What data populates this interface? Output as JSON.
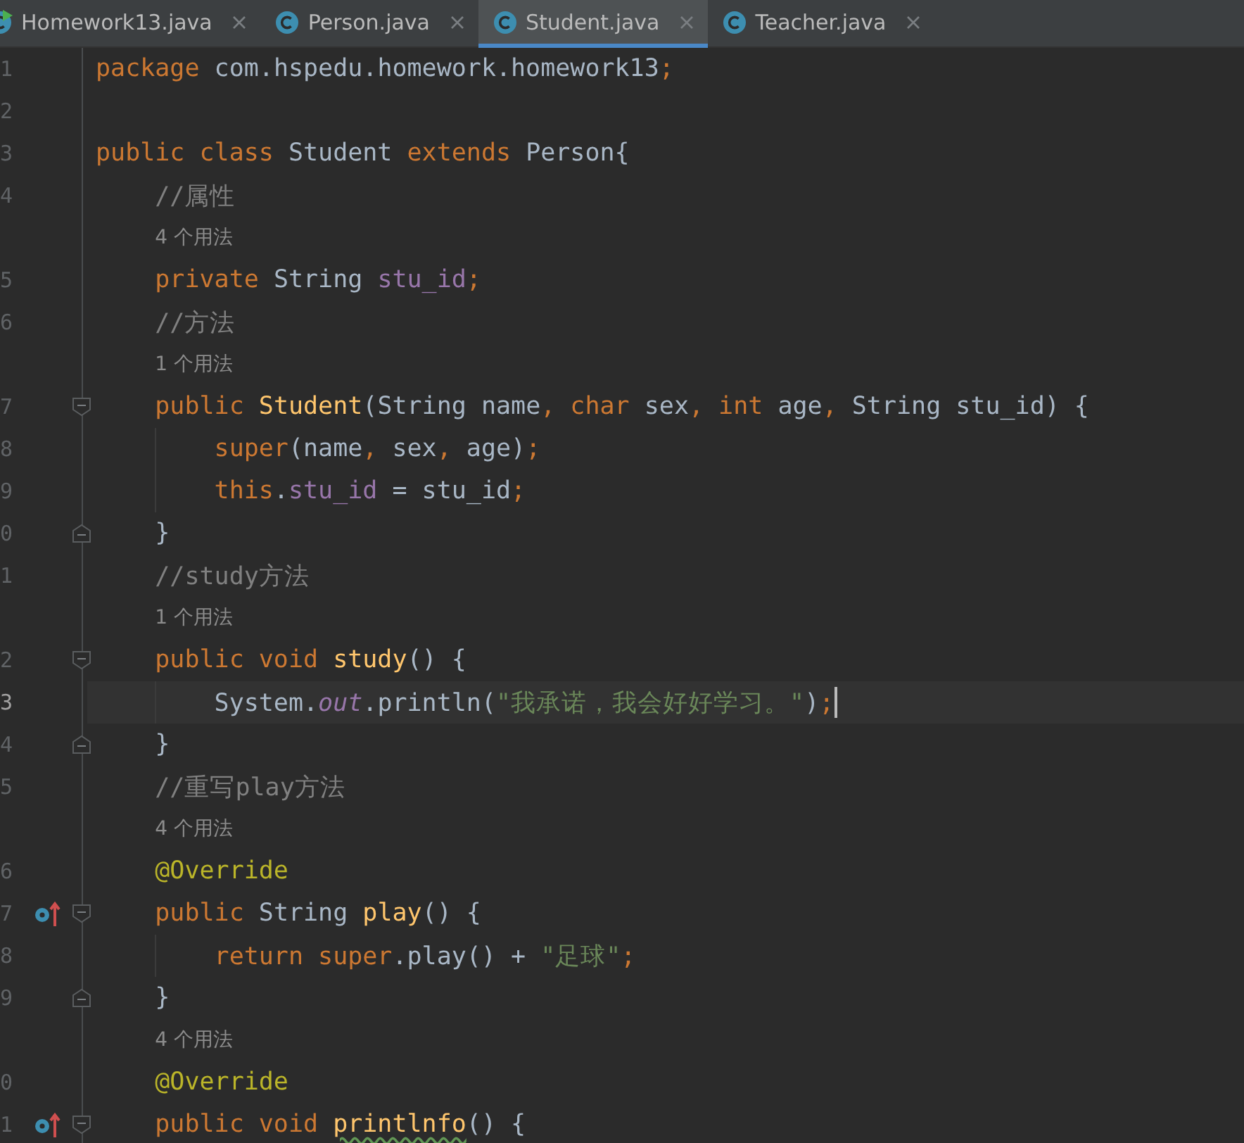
{
  "tabs": [
    {
      "label": "Homework13.java",
      "selected": false,
      "runnable": true
    },
    {
      "label": "Person.java",
      "selected": false,
      "runnable": false
    },
    {
      "label": "Student.java",
      "selected": true,
      "runnable": false
    },
    {
      "label": "Teacher.java",
      "selected": false,
      "runnable": false
    }
  ],
  "lines": [
    {
      "kind": "code",
      "number": "1",
      "current": false,
      "tokens": [
        {
          "kind": "kw",
          "text": "package "
        },
        {
          "kind": "plain",
          "text": "com.hspedu.homework.homework13"
        },
        {
          "kind": "kw",
          "text": ";"
        }
      ]
    },
    {
      "kind": "code",
      "number": "2",
      "current": false
    },
    {
      "kind": "code",
      "number": "3",
      "current": false,
      "tokens": [
        {
          "kind": "kw",
          "text": "public class "
        },
        {
          "kind": "plain",
          "text": "Student "
        },
        {
          "kind": "kw",
          "text": "extends "
        },
        {
          "kind": "plain",
          "text": "Person{"
        }
      ]
    },
    {
      "kind": "code",
      "number": "4",
      "current": false,
      "tokens": [
        {
          "kind": "comment",
          "text": "    //属性"
        }
      ]
    },
    {
      "kind": "hint",
      "text": "4 个用法"
    },
    {
      "kind": "code",
      "number": "5",
      "current": false,
      "tokens": [
        {
          "kind": "kw",
          "text": "    private "
        },
        {
          "kind": "plain",
          "text": "String "
        },
        {
          "kind": "field",
          "text": "stu_id"
        },
        {
          "kind": "kw",
          "text": ";"
        }
      ]
    },
    {
      "kind": "code",
      "number": "6",
      "current": false,
      "tokens": [
        {
          "kind": "comment",
          "text": "    //方法"
        }
      ]
    },
    {
      "kind": "hint",
      "text": "1 个用法"
    },
    {
      "kind": "code",
      "number": "7",
      "current": false,
      "fold": {
        "kind": "start"
      },
      "tokens": [
        {
          "kind": "kw",
          "text": "    public "
        },
        {
          "kind": "decl",
          "text": "Student"
        },
        {
          "kind": "plain",
          "text": "(String name"
        },
        {
          "kind": "kw",
          "text": ", char "
        },
        {
          "kind": "plain",
          "text": "sex"
        },
        {
          "kind": "kw",
          "text": ", int "
        },
        {
          "kind": "plain",
          "text": "age"
        },
        {
          "kind": "kw",
          "text": ", "
        },
        {
          "kind": "plain",
          "text": "String stu_id) {"
        }
      ]
    },
    {
      "kind": "code",
      "number": "8",
      "current": false,
      "tokens": [
        {
          "kind": "kw",
          "text": "        super"
        },
        {
          "kind": "plain",
          "text": "(name"
        },
        {
          "kind": "kw",
          "text": ", "
        },
        {
          "kind": "plain",
          "text": "sex"
        },
        {
          "kind": "kw",
          "text": ", "
        },
        {
          "kind": "plain",
          "text": "age)"
        },
        {
          "kind": "kw",
          "text": ";"
        }
      ]
    },
    {
      "kind": "code",
      "number": "9",
      "current": false,
      "tokens": [
        {
          "kind": "kw",
          "text": "        this"
        },
        {
          "kind": "plain",
          "text": "."
        },
        {
          "kind": "field",
          "text": "stu_id"
        },
        {
          "kind": "plain",
          "text": " = stu_id"
        },
        {
          "kind": "kw",
          "text": ";"
        }
      ]
    },
    {
      "kind": "code",
      "number": "0",
      "current": false,
      "fold": {
        "kind": "end"
      },
      "tokens": [
        {
          "kind": "plain",
          "text": "    }"
        }
      ]
    },
    {
      "kind": "code",
      "number": "1",
      "current": false,
      "tokens": [
        {
          "kind": "comment",
          "text": "    //study方法"
        }
      ]
    },
    {
      "kind": "hint",
      "text": "1 个用法"
    },
    {
      "kind": "code",
      "number": "2",
      "current": false,
      "fold": {
        "kind": "start"
      },
      "tokens": [
        {
          "kind": "kw",
          "text": "    public void "
        },
        {
          "kind": "decl",
          "text": "study"
        },
        {
          "kind": "plain",
          "text": "() {"
        }
      ]
    },
    {
      "kind": "code",
      "number": "3",
      "current": true,
      "tokens": [
        {
          "kind": "plain",
          "text": "        System."
        },
        {
          "kind": "static",
          "text": "out"
        },
        {
          "kind": "plain",
          "text": ".println("
        },
        {
          "kind": "string",
          "text": "\"我承诺，我会好好学习。\""
        },
        {
          "kind": "plain",
          "text": ")"
        },
        {
          "kind": "kw",
          "text": ";"
        }
      ]
    },
    {
      "kind": "code",
      "number": "4",
      "current": false,
      "fold": {
        "kind": "end"
      },
      "tokens": [
        {
          "kind": "plain",
          "text": "    }"
        }
      ]
    },
    {
      "kind": "code",
      "number": "5",
      "current": false,
      "tokens": [
        {
          "kind": "comment",
          "text": "    //重写play方法"
        }
      ]
    },
    {
      "kind": "hint",
      "text": "4 个用法"
    },
    {
      "kind": "code",
      "number": "6",
      "current": false,
      "tokens": [
        {
          "kind": "annotation",
          "text": "    @Override"
        }
      ]
    },
    {
      "kind": "code",
      "number": "7",
      "current": false,
      "fold": {
        "kind": "start"
      },
      "marker": {
        "kind": "override"
      },
      "tokens": [
        {
          "kind": "kw",
          "text": "    public "
        },
        {
          "kind": "plain",
          "text": "String "
        },
        {
          "kind": "decl",
          "text": "play"
        },
        {
          "kind": "plain",
          "text": "() {"
        }
      ]
    },
    {
      "kind": "code",
      "number": "8",
      "current": false,
      "tokens": [
        {
          "kind": "kw",
          "text": "        return super"
        },
        {
          "kind": "plain",
          "text": ".play() + "
        },
        {
          "kind": "string",
          "text": "\"足球\""
        },
        {
          "kind": "kw",
          "text": ";"
        }
      ]
    },
    {
      "kind": "code",
      "number": "9",
      "current": false,
      "fold": {
        "kind": "end"
      },
      "tokens": [
        {
          "kind": "plain",
          "text": "    }"
        }
      ]
    },
    {
      "kind": "hint",
      "text": "4 个用法"
    },
    {
      "kind": "code",
      "number": "0",
      "current": false,
      "tokens": [
        {
          "kind": "annotation",
          "text": "    @Override"
        }
      ]
    },
    {
      "kind": "code",
      "number": "1",
      "current": false,
      "fold": {
        "kind": "start"
      },
      "marker": {
        "kind": "override"
      },
      "tokens": [
        {
          "kind": "kw",
          "text": "    public void "
        },
        {
          "kind": "decl",
          "text": "printlnfo",
          "typo": true
        },
        {
          "kind": "plain",
          "text": "() {"
        }
      ]
    }
  ]
}
